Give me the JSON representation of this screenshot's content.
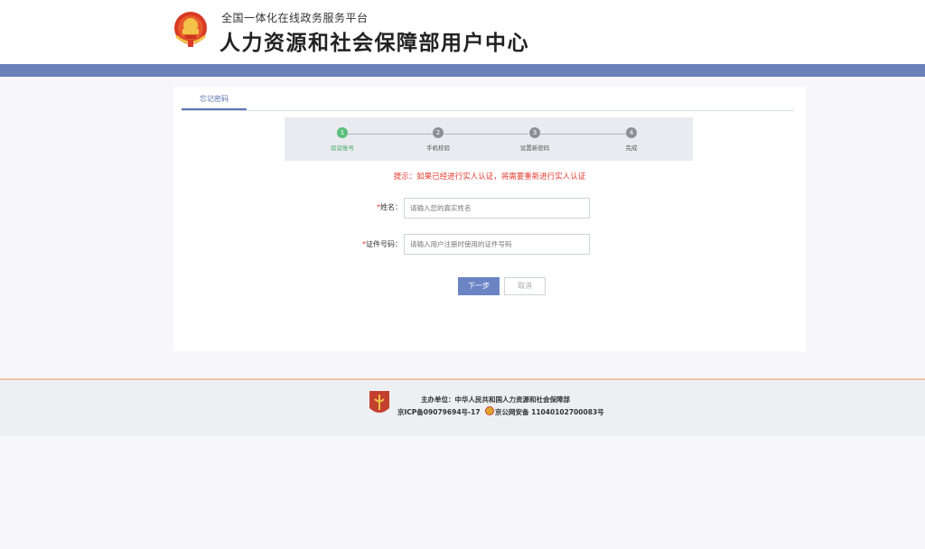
{
  "header": {
    "subtitle": "全国一体化在线政务服务平台",
    "title": "人力资源和社会保障部用户中心"
  },
  "tabs": [
    {
      "label": "忘记密码"
    }
  ],
  "steps": [
    {
      "number": "1",
      "label": "验证账号"
    },
    {
      "number": "2",
      "label": "手机校验"
    },
    {
      "number": "3",
      "label": "设置新密码"
    },
    {
      "number": "4",
      "label": "完成"
    }
  ],
  "notice": "提示：如果已经进行实人认证，将需要重新进行实人认证",
  "form": {
    "name_label": "姓名：",
    "name_placeholder": "请输入您的真实姓名",
    "id_label": "证件号码：",
    "id_placeholder": "请输入用户注册时使用的证件号码",
    "required_mark": "*"
  },
  "buttons": {
    "next": "下一步",
    "cancel": "取消"
  },
  "footer": {
    "host": "主办单位：中华人民共和国人力资源和社会保障部",
    "icp": "京ICP备09079694号-17",
    "police": "京公网安备 11040102700083号"
  },
  "colors": {
    "navbar": "#6b7fb8",
    "accent": "#5b73b6",
    "active_step": "#5cbf7b",
    "notice": "#e23a2d"
  }
}
